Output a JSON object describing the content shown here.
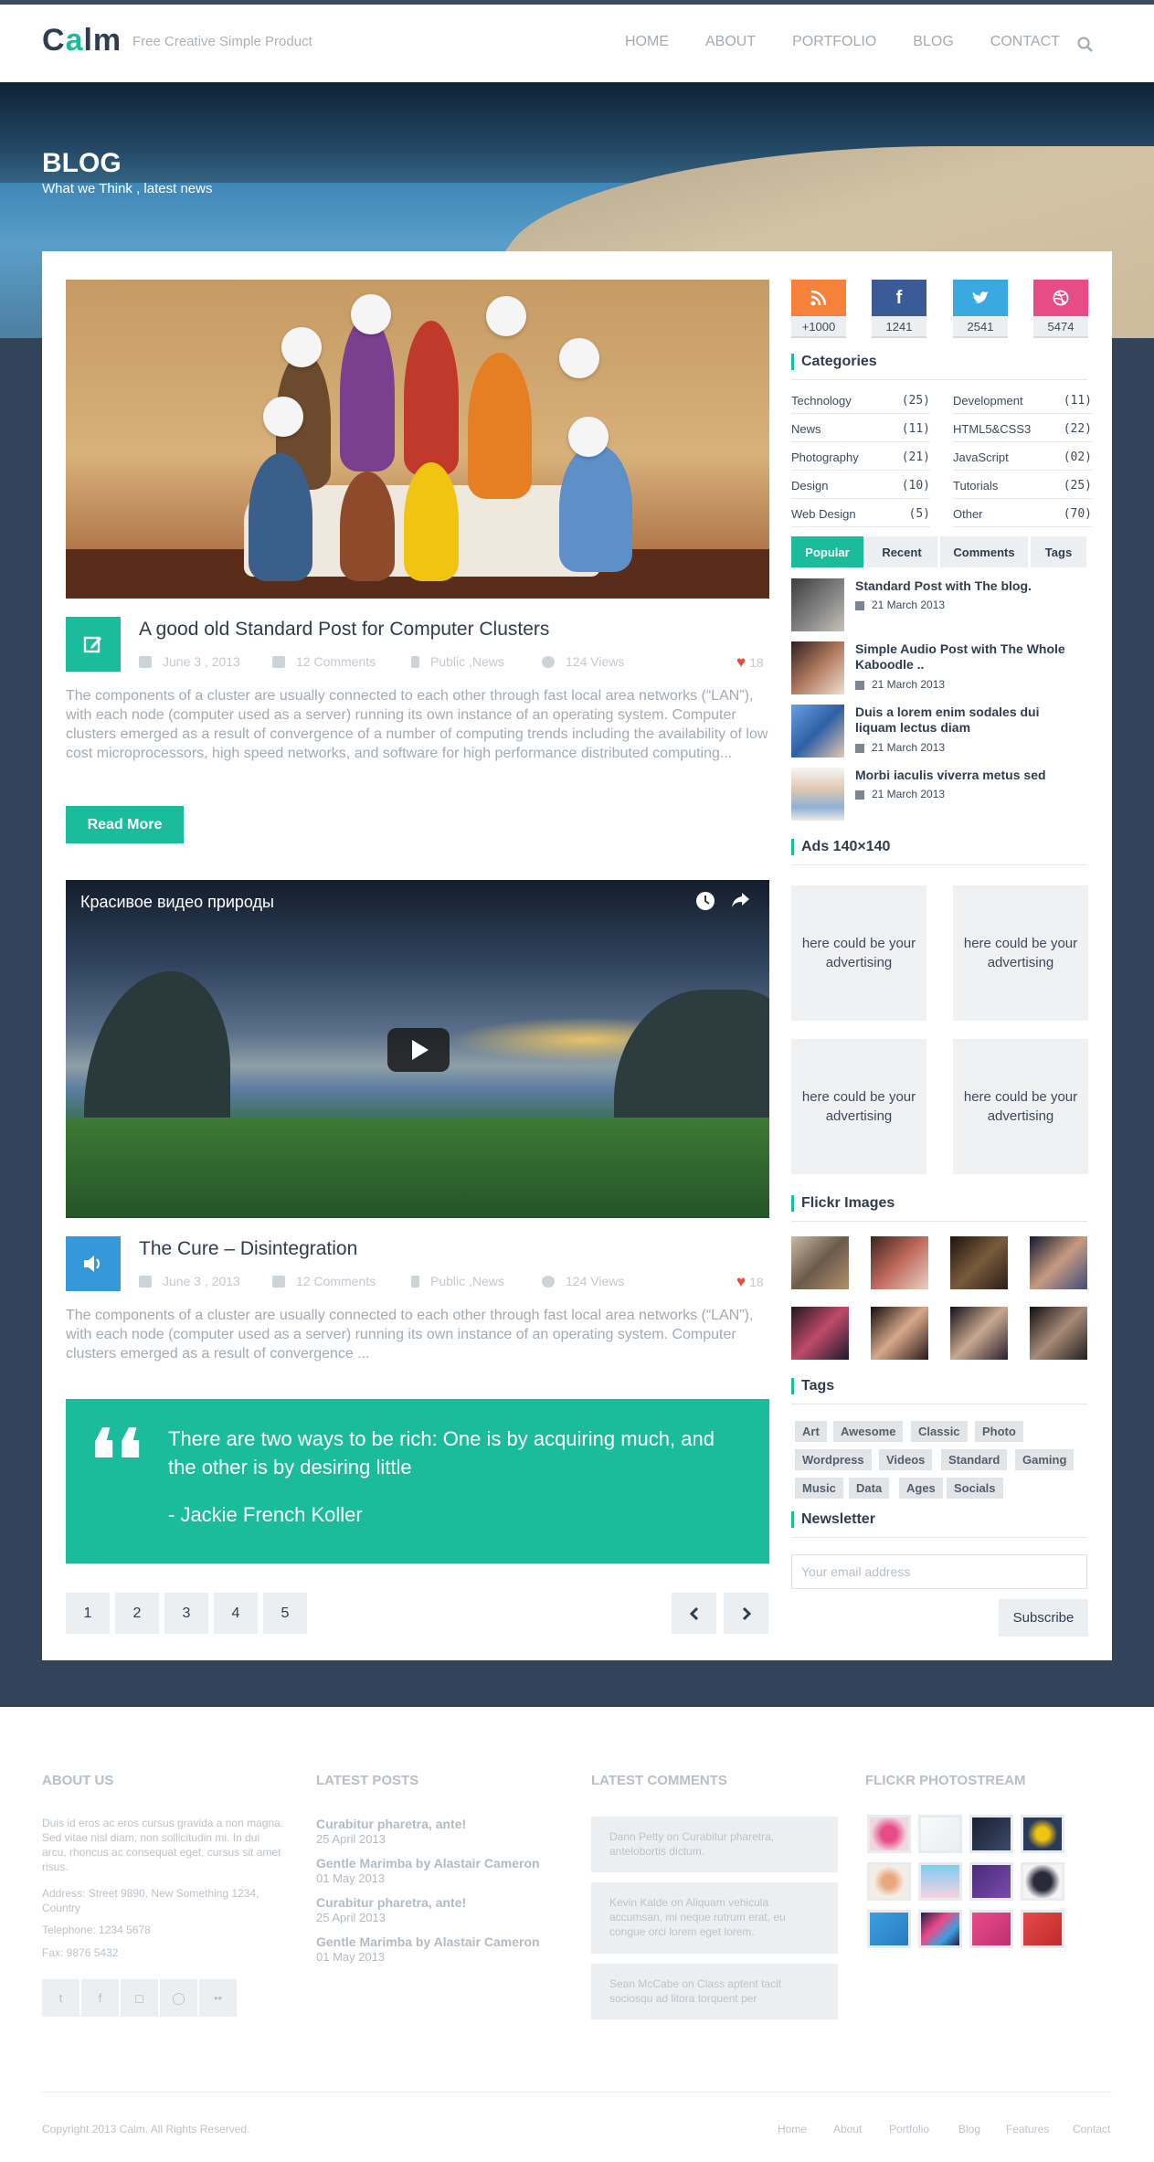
{
  "header": {
    "logo": "Calm",
    "tagline": "Free Creative Simple Product",
    "nav": [
      "HOME",
      "ABOUT",
      "PORTFOLIO",
      "BLOG",
      "CONTACT"
    ]
  },
  "hero": {
    "title": "BLOG",
    "subtitle": "What we Think , latest news"
  },
  "posts": [
    {
      "title": "A good old Standard Post for Computer Clusters",
      "date": "June 3 , 2013",
      "comments": "12 Comments",
      "category": "Public ,News",
      "views": "124 Views",
      "likes": "18",
      "excerpt": "The components of a cluster are usually connected to each other through fast local area networks (“LAN”), with each node (computer used as a server) running its own instance of an operating system. Computer clusters emerged as a result of convergence of a number of computing trends including the availability of low cost microprocessors, high speed networks, and software for high performance distributed computing...",
      "read_more": "Read More"
    },
    {
      "video_title": "Красивое видео природы",
      "title": "The Cure – Disintegration",
      "date": "June 3 , 2013",
      "comments": "12 Comments",
      "category": "Public ,News",
      "views": "124 Views",
      "likes": "18",
      "excerpt": "The components of a cluster are usually connected to each other through fast local area networks (“LAN”), with each node (computer used as a server) running its own instance of an operating system. Computer clusters emerged as a result of convergence ..."
    }
  ],
  "quote": {
    "text": "There are two ways to be rich: One is by acquiring much, and the other is by desiring little",
    "author": "- Jackie French Koller"
  },
  "pagination": [
    "1",
    "2",
    "3",
    "4",
    "5"
  ],
  "social": [
    {
      "icon": "rss-icon",
      "count": "+1000",
      "color": "#f5813a"
    },
    {
      "icon": "facebook-icon",
      "count": "1241",
      "color": "#3b5b98"
    },
    {
      "icon": "twitter-icon",
      "count": "2541",
      "color": "#39a9e0"
    },
    {
      "icon": "dribbble-icon",
      "count": "5474",
      "color": "#e84c88"
    }
  ],
  "categories": {
    "title": "Categories",
    "left": [
      {
        "name": "Technology",
        "count": "(25)"
      },
      {
        "name": "News",
        "count": "(11)"
      },
      {
        "name": "Photography",
        "count": "(21)"
      },
      {
        "name": "Design",
        "count": "(10)"
      },
      {
        "name": "Web Design",
        "count": "(5)"
      }
    ],
    "right": [
      {
        "name": "Development",
        "count": "(11)"
      },
      {
        "name": "HTML5&CSS3",
        "count": "(22)"
      },
      {
        "name": "JavaScript",
        "count": "(02)"
      },
      {
        "name": "Tutorials",
        "count": "(25)"
      },
      {
        "name": "Other",
        "count": "(70)"
      }
    ]
  },
  "tabs": [
    "Popular",
    "Recent",
    "Comments",
    "Tags"
  ],
  "popular": [
    {
      "title": "Standard Post with The blog.",
      "date": "21 March 2013"
    },
    {
      "title": "Simple Audio Post with The Whole Kaboodle ..",
      "date": "21 March 2013"
    },
    {
      "title": "Duis a lorem enim sodales dui liquam lectus diam",
      "date": "21 March 2013"
    },
    {
      "title": "Morbi iaculis viverra metus sed",
      "date": "21 March 2013"
    }
  ],
  "ads": {
    "title": "Ads 140×140",
    "items": [
      "here could be your advertising",
      "here could be your advertising",
      "here could be your advertising",
      "here could be your advertising"
    ]
  },
  "flickr": {
    "title": "Flickr Images"
  },
  "tags": {
    "title": "Tags",
    "items": [
      "Art",
      "Awesome",
      "Classic",
      "Photo",
      "Wordpress",
      "Videos",
      "Standard",
      "Gaming",
      "Music",
      "Data",
      "Ages",
      "Socials"
    ]
  },
  "newsletter": {
    "title": "Newsletter",
    "placeholder": "Your email address",
    "button": "Subscribe"
  },
  "footer": {
    "about": {
      "title": "ABOUT US",
      "text": "Duis id eros ac eros cursus gravida a non magna. Sed vitae nisl diam, non sollicitudin mi. In dui arcu, rhoncus ac consequat eget, cursus sit amet risus.",
      "address": "Address: Street 9890, New Something 1234, Country",
      "telephone": "Telephone: 1234 5678",
      "fax": "Fax: 9876 5432"
    },
    "latest_posts": {
      "title": "LATEST POSTS",
      "items": [
        {
          "title": "Curabitur pharetra, ante!",
          "date": "25 April 2013"
        },
        {
          "title": "Gentle Marimba by Alastair Cameron",
          "date": "01 May 2013"
        },
        {
          "title": "Curabitur pharetra, ante!",
          "date": "25 April 2013"
        },
        {
          "title": "Gentle Marimba by Alastair Cameron",
          "date": "01 May 2013"
        }
      ]
    },
    "latest_comments": {
      "title": "LATEST COMMENTS",
      "items": [
        "Dann Petty on Curabitur pharetra, antelobortis dictum.",
        "Kevin Kalde on Aliquam vehicula accumsan, mi neque rutrum erat, eu congue orci lorem eget lorem.",
        "Sean McCabe on Class aptent tacit sociosqu ad litora torquent per"
      ]
    },
    "flickr": {
      "title": "FLICKR PHOTOSTREAM"
    },
    "copyright": "Copyright 2013 Calm. All Rights Reserved.",
    "nav": [
      "Home",
      "About",
      "Portfolio",
      "Blog",
      "Features",
      "Contact"
    ]
  }
}
